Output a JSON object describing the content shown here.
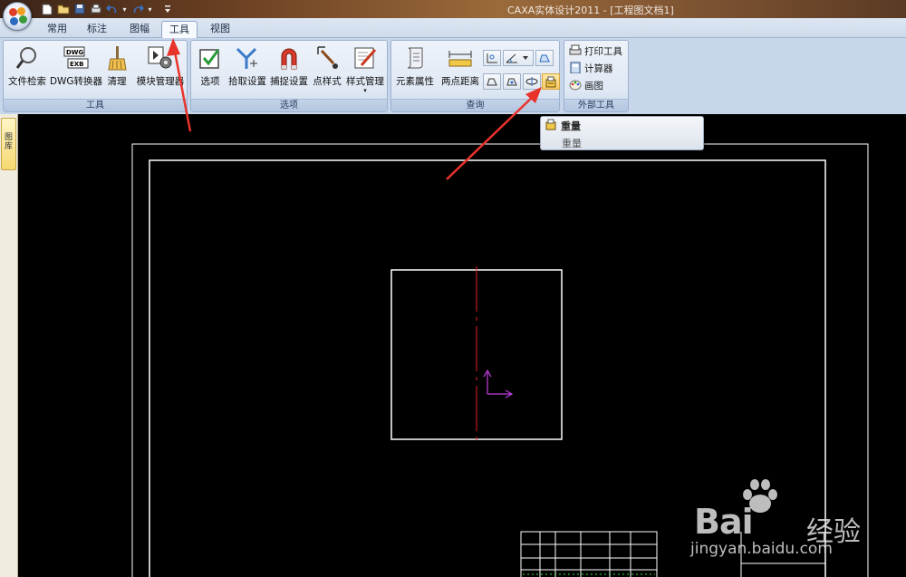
{
  "window": {
    "title": "CAXA实体设计2011 - [工程图文档1]"
  },
  "quick_access": {
    "icons": [
      "new-file-icon",
      "open-file-icon",
      "save-icon",
      "print-icon",
      "undo-icon",
      "redo-icon",
      "customize-icon"
    ],
    "dropdown_glyph": "▾"
  },
  "tabs": [
    {
      "label": "常用",
      "active": false
    },
    {
      "label": "标注",
      "active": false
    },
    {
      "label": "图幅",
      "active": false
    },
    {
      "label": "工具",
      "active": true
    },
    {
      "label": "视图",
      "active": false
    }
  ],
  "ribbon": {
    "tools_group": {
      "label": "工具",
      "buttons": [
        {
          "label": "文件检索",
          "icon": "magnifier-icon"
        },
        {
          "label": "DWG转换器",
          "icon": "dwg-exb-icon",
          "icon_text_top": "DWG",
          "icon_text_bottom": "EXB"
        },
        {
          "label": "清理",
          "icon": "broom-icon"
        },
        {
          "label": "模块管理器",
          "icon": "module-gear-icon"
        }
      ]
    },
    "options_group": {
      "label": "选项",
      "buttons": [
        {
          "label": "选项",
          "icon": "checkbox-icon"
        },
        {
          "label": "拾取设置",
          "icon": "pick-filter-icon"
        },
        {
          "label": "捕捉设置",
          "icon": "magnet-icon"
        },
        {
          "label": "点样式",
          "icon": "point-style-icon"
        },
        {
          "label": "样式管理",
          "icon": "style-manager-icon",
          "has_dropdown": true
        }
      ]
    },
    "query_group": {
      "label": "查询",
      "buttons": [
        {
          "label": "元素属性",
          "icon": "scroll-icon"
        },
        {
          "label": "两点距离",
          "icon": "distance-ruler-icon"
        }
      ],
      "small_icons": [
        "coordinate-icon",
        "angle-icon",
        "area-icon",
        "perimeter-icon",
        "centroid-icon",
        "inertia-icon",
        "weight-icon"
      ]
    },
    "external_group": {
      "label": "外部工具",
      "items": [
        {
          "label": "打印工具",
          "icon": "printer-icon"
        },
        {
          "label": "计算器",
          "icon": "calculator-icon"
        },
        {
          "label": "画图",
          "icon": "paint-icon"
        }
      ]
    }
  },
  "dropdown_tip": {
    "title": "重量",
    "description": "重量"
  },
  "side_panel": {
    "tab_label": "图库"
  },
  "watermark": {
    "brand": "Bai",
    "brand_suffix": "经验",
    "url": "jingyan.baidu.com"
  },
  "colors": {
    "arrow": "#e8332a",
    "centerline": "#e0202a",
    "ucs_axis": "#c040e0",
    "drawing_line": "#ffffff",
    "title_block_text": "#30e030",
    "canvas": "#000000"
  }
}
